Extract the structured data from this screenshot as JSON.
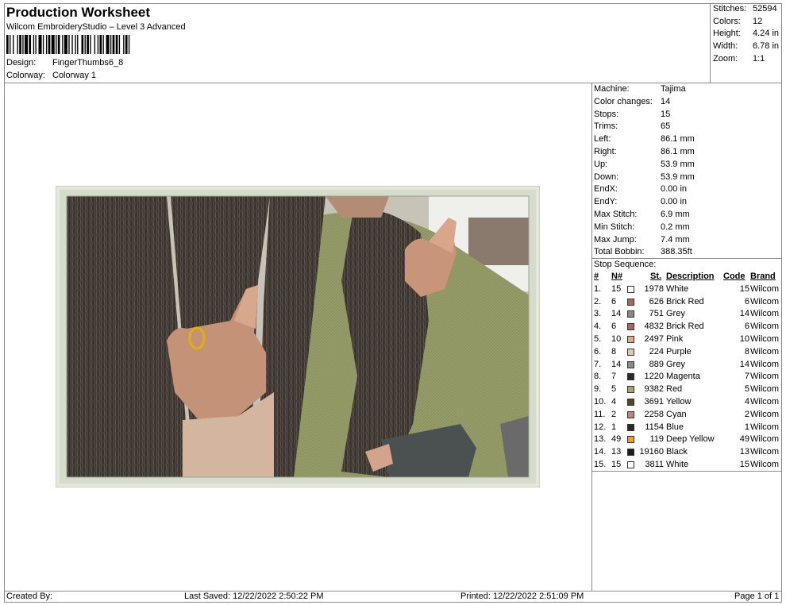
{
  "header": {
    "title": "Production Worksheet",
    "subtitle": "Wilcom EmbroideryStudio – Level 3 Advanced",
    "design_label": "Design:",
    "design_value": "FingerThumbs6_8",
    "colorway_label": "Colorway:",
    "colorway_value": "Colorway 1"
  },
  "stats": [
    {
      "label": "Stitches:",
      "value": "52594"
    },
    {
      "label": "Colors:",
      "value": "12"
    },
    {
      "label": "Height:",
      "value": "4.24 in"
    },
    {
      "label": "Width:",
      "value": "6.78 in"
    },
    {
      "label": "Zoom:",
      "value": "1:1"
    }
  ],
  "machine": [
    {
      "label": "Machine:",
      "value": "Tajima"
    },
    {
      "label": "Color changes:",
      "value": "14"
    },
    {
      "label": "Stops:",
      "value": "15"
    },
    {
      "label": "Trims:",
      "value": "65"
    },
    {
      "label": "Left:",
      "value": "86.1 mm"
    },
    {
      "label": "Right:",
      "value": "86.1 mm"
    },
    {
      "label": "Up:",
      "value": "53.9 mm"
    },
    {
      "label": "Down:",
      "value": "53.9 mm"
    },
    {
      "label": "EndX:",
      "value": "0.00 in"
    },
    {
      "label": "EndY:",
      "value": "0.00 in"
    },
    {
      "label": "Max Stitch:",
      "value": "6.9 mm"
    },
    {
      "label": "Min Stitch:",
      "value": "0.2 mm"
    },
    {
      "label": "Max Jump:",
      "value": "7.4 mm"
    },
    {
      "label": "Total Bobbin:",
      "value": "388.35ft"
    }
  ],
  "stop_sequence": {
    "title": "Stop Sequence:",
    "headers": {
      "num": "#",
      "n": "N#",
      "st": "St.",
      "desc": "Description",
      "code": "Code",
      "brand": "Brand"
    },
    "rows": [
      {
        "num": "1.",
        "n": "15",
        "color": "#ffffff",
        "st": "1978",
        "desc": "White",
        "code": "15",
        "brand": "Wilcom"
      },
      {
        "num": "2.",
        "n": "6",
        "color": "#b0645e",
        "st": "626",
        "desc": "Brick Red",
        "code": "6",
        "brand": "Wilcom"
      },
      {
        "num": "3.",
        "n": "14",
        "color": "#8a8a8a",
        "st": "751",
        "desc": "Grey",
        "code": "14",
        "brand": "Wilcom"
      },
      {
        "num": "4.",
        "n": "6",
        "color": "#b0645e",
        "st": "4832",
        "desc": "Brick Red",
        "code": "6",
        "brand": "Wilcom"
      },
      {
        "num": "5.",
        "n": "10",
        "color": "#f0a486",
        "st": "2497",
        "desc": "Pink",
        "code": "10",
        "brand": "Wilcom"
      },
      {
        "num": "6.",
        "n": "8",
        "color": "#dcc8ae",
        "st": "224",
        "desc": "Purple",
        "code": "8",
        "brand": "Wilcom"
      },
      {
        "num": "7.",
        "n": "14",
        "color": "#8a8a8a",
        "st": "889",
        "desc": "Grey",
        "code": "14",
        "brand": "Wilcom"
      },
      {
        "num": "8.",
        "n": "7",
        "color": "#2a2a2a",
        "st": "1220",
        "desc": "Magenta",
        "code": "7",
        "brand": "Wilcom"
      },
      {
        "num": "9.",
        "n": "5",
        "color": "#a5a276",
        "st": "9382",
        "desc": "Red",
        "code": "5",
        "brand": "Wilcom"
      },
      {
        "num": "10.",
        "n": "4",
        "color": "#4f4a2e",
        "st": "3691",
        "desc": "Yellow",
        "code": "4",
        "brand": "Wilcom"
      },
      {
        "num": "11.",
        "n": "2",
        "color": "#b88a7e",
        "st": "2258",
        "desc": "Cyan",
        "code": "2",
        "brand": "Wilcom"
      },
      {
        "num": "12.",
        "n": "1",
        "color": "#2e2624",
        "st": "1154",
        "desc": "Blue",
        "code": "1",
        "brand": "Wilcom"
      },
      {
        "num": "13.",
        "n": "49",
        "color": "#f4a000",
        "st": "119",
        "desc": "Deep Yellow",
        "code": "49",
        "brand": "Wilcom"
      },
      {
        "num": "14.",
        "n": "13",
        "color": "#1a1a1a",
        "st": "19160",
        "desc": "Black",
        "code": "13",
        "brand": "Wilcom"
      },
      {
        "num": "15.",
        "n": "15",
        "color": "#ffffff",
        "st": "3811",
        "desc": "White",
        "code": "15",
        "brand": "Wilcom"
      }
    ]
  },
  "footer": {
    "created_by": "Created By:",
    "last_saved": "Last Saved: 12/22/2022 2:50:22 PM",
    "printed": "Printed: 12/22/2022 2:51:09 PM",
    "page": "Page 1 of 1"
  }
}
